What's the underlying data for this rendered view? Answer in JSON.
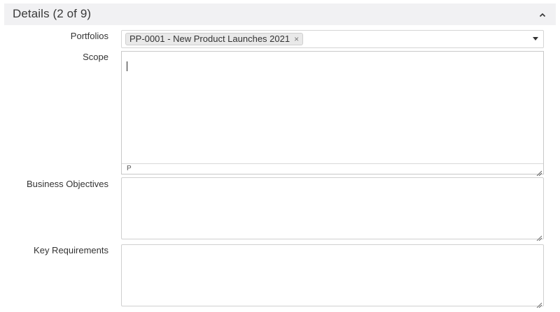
{
  "section": {
    "title": "Details (2 of 9)",
    "toggle_icon": "chevron-up-icon"
  },
  "fields": {
    "portfolios": {
      "label": "Portfolios",
      "selected_tags": [
        "PP-0001 - New Product Launches 2021"
      ],
      "remove_glyph": "×"
    },
    "scope": {
      "label": "Scope",
      "value": "",
      "status_path": "P"
    },
    "business_objectives": {
      "label": "Business Objectives",
      "value": ""
    },
    "key_requirements": {
      "label": "Key Requirements",
      "value": ""
    }
  }
}
